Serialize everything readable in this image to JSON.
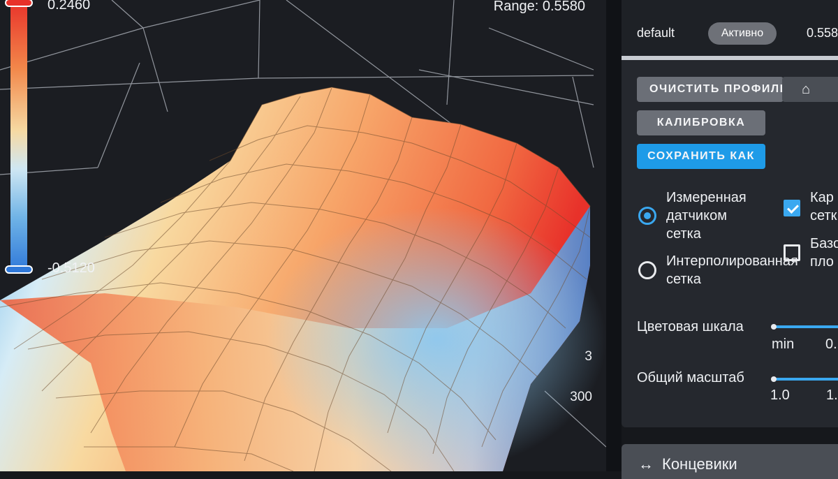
{
  "viewport": {
    "scale_max": "0.2460",
    "scale_min": "-0.5120",
    "range_text": "Range: 0.5580",
    "axis_ticks": [
      "3",
      "300"
    ],
    "colors": {
      "hot": "#e8312a",
      "warm": "#f2874a",
      "neutral": "#f6d9a2",
      "cool": "#6fb3e6",
      "cold": "#2f78d9"
    }
  },
  "panel": {
    "profile": {
      "name": "default",
      "status": "Активно",
      "range": "0.558"
    },
    "buttons": {
      "clear": "ОЧИСТИТЬ ПРОФИЛЬ",
      "home": "⌂",
      "calibration": "КАЛИБРОВКА",
      "save_as": "СОХРАНИТЬ КАК"
    },
    "mesh_options": {
      "measured": "Измеренная датчиком сетка",
      "interpolated": "Интерполированная сетка",
      "selected": "measured"
    },
    "view_options": {
      "option1_fragment": "Кар сетк",
      "option1_checked": true,
      "option2_fragment": "Базо пло",
      "option2_checked": false
    },
    "color_scale": {
      "label": "Цветовая шкала",
      "min_text": "min",
      "max_text": "0."
    },
    "overall_scale": {
      "label": "Общий масштаб",
      "value_left": "1.0",
      "value_right": "1."
    }
  },
  "bottom_panel": {
    "icon": "↔",
    "label": "Концевики"
  }
}
